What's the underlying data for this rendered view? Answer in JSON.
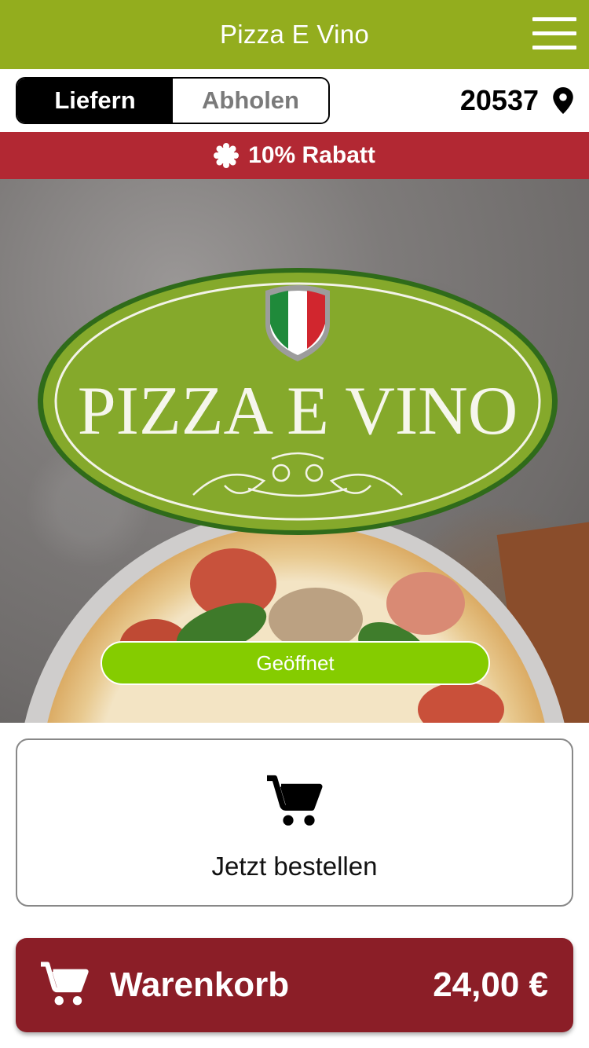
{
  "app": {
    "title": "Pizza E Vino"
  },
  "delivery_toggle": {
    "options": [
      "Liefern",
      "Abholen"
    ],
    "selected": "Liefern"
  },
  "location": {
    "zip": "20537",
    "icon": "location-pin-icon"
  },
  "banner": {
    "text": "10% Rabatt",
    "icon": "badge-icon"
  },
  "hero": {
    "logo_text": "PIZZA E VINO",
    "status": "Geöffnet"
  },
  "order": {
    "label": "Jetzt bestellen",
    "icon": "cart-icon"
  },
  "cart": {
    "label": "Warenkorb",
    "total": "24,00 €",
    "icon": "cart-icon"
  },
  "colors": {
    "header": "#93ad1e",
    "banner": "#b22833",
    "status": "#85cc00",
    "cart_bar": "#8b1e27"
  }
}
